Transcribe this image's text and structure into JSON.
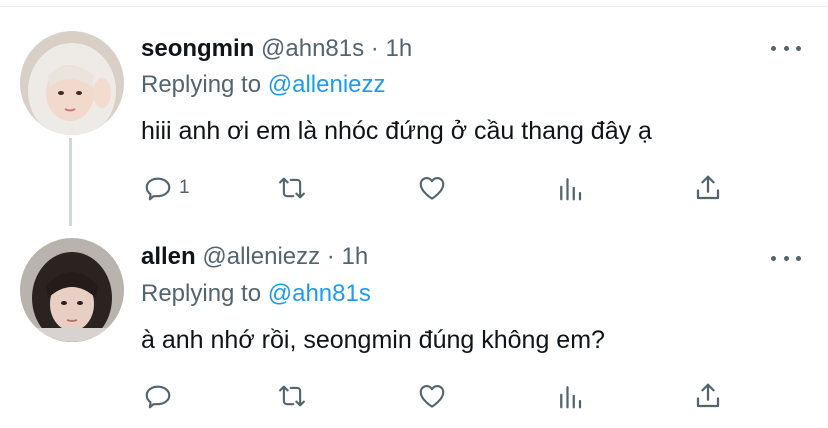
{
  "tweets": [
    {
      "name": "seongmin",
      "handle": "@ahn81s",
      "separator": "·",
      "time": "1h",
      "replying_prefix": "Replying to",
      "replying_to": "@alleniezz",
      "text": "hiii anh ơi em là nhóc đứng ở cầu thang đây ạ",
      "reply_count": "1",
      "icons": [
        "reply-icon",
        "retweet-icon",
        "like-icon",
        "analytics-icon",
        "share-icon",
        "more-icon"
      ]
    },
    {
      "name": "allen",
      "handle": "@alleniezz",
      "separator": "·",
      "time": "1h",
      "replying_prefix": "Replying to",
      "replying_to": "@ahn81s",
      "text": "à anh nhớ rồi, seongmin đúng không em?",
      "reply_count": "",
      "icons": [
        "reply-icon",
        "retweet-icon",
        "like-icon",
        "analytics-icon",
        "share-icon",
        "more-icon"
      ]
    }
  ],
  "colors": {
    "link": "#1d9bf0",
    "secondary": "#536471",
    "text": "#0f1419",
    "divider": "#cfd9de"
  }
}
